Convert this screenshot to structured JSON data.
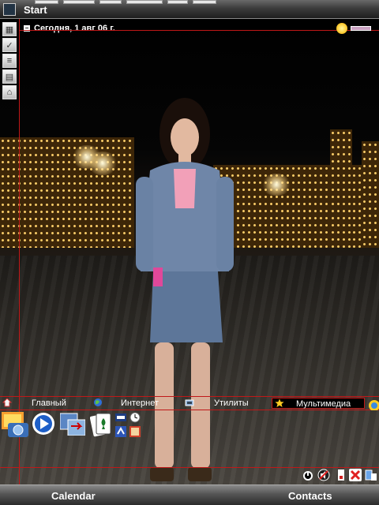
{
  "topbar": {
    "start_label": "Start"
  },
  "today": {
    "collapse_symbol": "−",
    "date_label": "Сегодня, 1 авг 06 г."
  },
  "tabs": [
    {
      "label": "Главный",
      "icon": "home-icon"
    },
    {
      "label": "Интернет",
      "icon": "globe-icon"
    },
    {
      "label": "Утилиты",
      "icon": "utilities-icon"
    },
    {
      "label": "Мультимедиа",
      "icon": "star-icon"
    }
  ],
  "left_icons": [
    "calendar-icon",
    "tasks-icon",
    "notes-icon",
    "documents-icon",
    "home-icon"
  ],
  "apps": [
    "pictures-icon",
    "media-player-icon",
    "transfer-icon",
    "solitaire-icon",
    "camera-icon",
    "clock-icon",
    "settings-icon",
    "video-icon"
  ],
  "system_icons": [
    "alarm-icon",
    "volume-icon",
    "battery-icon",
    "signal-off-icon",
    "connectivity-icon"
  ],
  "softkeys": {
    "left": "Calendar",
    "right": "Contacts"
  },
  "colors": {
    "accent_line": "#c01818",
    "bar_top": "#6a6a6a",
    "bar_bottom": "#1e1e1e"
  }
}
